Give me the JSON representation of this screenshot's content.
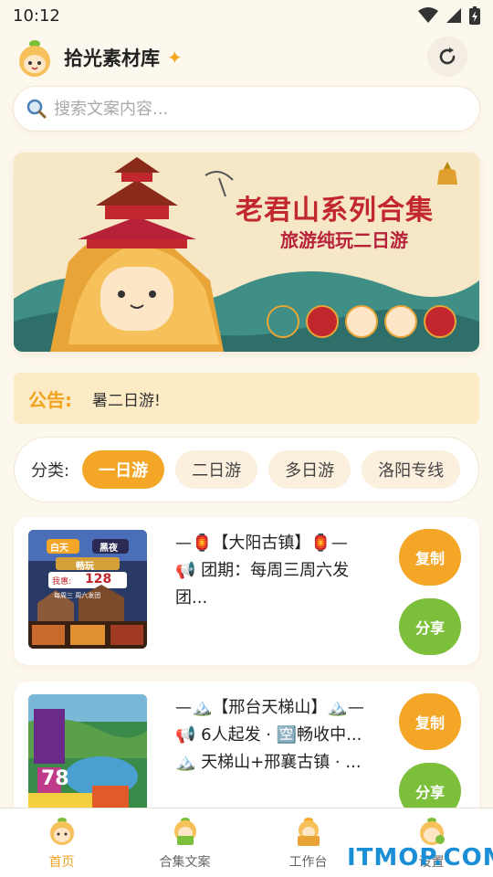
{
  "status": {
    "time": "10:12"
  },
  "header": {
    "title": "拾光素材库",
    "sparkle": "✦"
  },
  "search": {
    "placeholder": "搜索文案内容..."
  },
  "banner": {
    "title": "老君山系列合集",
    "subtitle": "旅游纯玩二日游"
  },
  "notice": {
    "label": "公告:",
    "text": "暑二日游!"
  },
  "categories": {
    "label": "分类:",
    "items": [
      "一日游",
      "二日游",
      "多日游",
      "洛阳专线"
    ],
    "active": "一日游"
  },
  "cards": [
    {
      "lines": [
        "—🏮【大阳古镇】🏮—",
        "📢 团期：每周三周六发",
        "团..."
      ],
      "thumb_texts": {
        "day": "白天",
        "night": "黑夜",
        "tag": "畅玩",
        "price_label": "我惠:",
        "price": "128",
        "days": "每周三 周六发团"
      },
      "copy_label": "复制",
      "share_label": "分享"
    },
    {
      "lines": [
        "—🏔️【邢台天梯山】🏔️—",
        "📢 6人起发 · 🈳畅收中...",
        "🏔️ 天梯山+邢襄古镇 · ..."
      ],
      "thumb_texts": {
        "price": "78"
      },
      "copy_label": "复制",
      "share_label": "分享"
    }
  ],
  "tabs": [
    {
      "label": "首页",
      "icon": "mascot-home-icon",
      "active": true
    },
    {
      "label": "合集文案",
      "icon": "mascot-collection-icon",
      "active": false
    },
    {
      "label": "工作台",
      "icon": "mascot-workbench-icon",
      "active": false
    },
    {
      "label": "设置",
      "icon": "mascot-settings-icon",
      "active": false
    }
  ],
  "watermark": "ITMOP.COM",
  "colors": {
    "accent": "#f4a627",
    "share": "#7cbf3a",
    "background": "#fdf8ee",
    "banner_red": "#c1272d"
  }
}
